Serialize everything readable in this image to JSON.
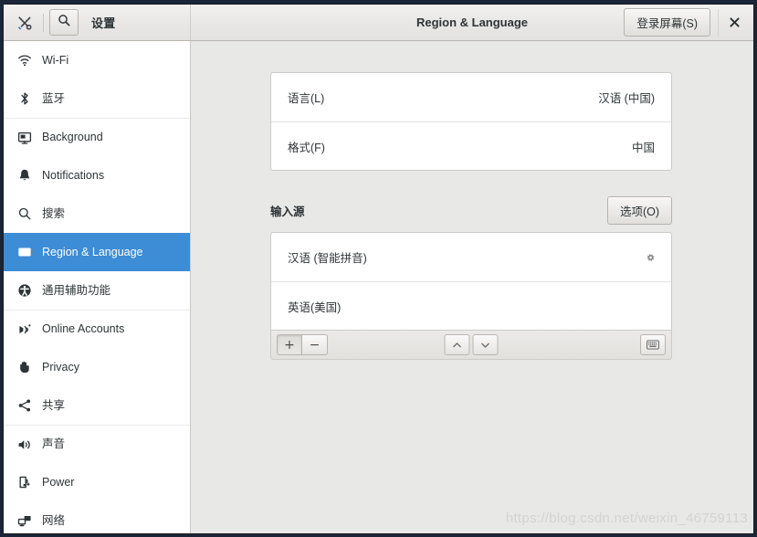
{
  "window": {
    "app_icon": "tools-icon",
    "sidebar_title": "设置",
    "title": "Region & Language",
    "login_screen_button": "登录屏幕(S)",
    "close_label": "✕",
    "search_icon": "search-icon"
  },
  "sidebar": {
    "items": [
      {
        "label": "Wi-Fi",
        "icon": "wifi-icon",
        "selected": false,
        "group_start": false
      },
      {
        "label": "蓝牙",
        "icon": "bluetooth-icon",
        "selected": false,
        "group_start": false
      },
      {
        "label": "Background",
        "icon": "monitor-icon",
        "selected": false,
        "group_start": true
      },
      {
        "label": "Notifications",
        "icon": "bell-icon",
        "selected": false,
        "group_start": false
      },
      {
        "label": "搜索",
        "icon": "search-icon",
        "selected": false,
        "group_start": false
      },
      {
        "label": "Region & Language",
        "icon": "region-language-icon",
        "selected": true,
        "group_start": false
      },
      {
        "label": "通用辅助功能",
        "icon": "accessibility-icon",
        "selected": false,
        "group_start": false
      },
      {
        "label": "Online Accounts",
        "icon": "online-accounts-icon",
        "selected": false,
        "group_start": true
      },
      {
        "label": "Privacy",
        "icon": "hand-icon",
        "selected": false,
        "group_start": false
      },
      {
        "label": "共享",
        "icon": "share-icon",
        "selected": false,
        "group_start": false
      },
      {
        "label": "声音",
        "icon": "speaker-icon",
        "selected": false,
        "group_start": true
      },
      {
        "label": "Power",
        "icon": "battery-icon",
        "selected": false,
        "group_start": false
      },
      {
        "label": "网络",
        "icon": "network-icon",
        "selected": false,
        "group_start": false
      }
    ]
  },
  "main": {
    "language_rows": [
      {
        "label": "语言(L)",
        "value": "汉语 (中国)"
      },
      {
        "label": "格式(F)",
        "value": "中国"
      }
    ],
    "input_sources": {
      "title": "输入源",
      "options_button": "选项(O)",
      "items": [
        {
          "label": "汉语 (智能拼音)",
          "has_settings": true
        },
        {
          "label": "英语(美国)",
          "has_settings": false
        }
      ],
      "toolbar": {
        "add_label": "+",
        "remove_label": "−",
        "move_up_label": "⌃",
        "move_down_label": "⌄",
        "keyboard_label": "⌨"
      }
    }
  },
  "watermark": "https://blog.csdn.net/weixin_46759113",
  "colors": {
    "accent": "#3d8cd6",
    "content_bg": "#e8e8e7",
    "sidebar_bg": "#ffffff",
    "text": "#2e3436"
  }
}
